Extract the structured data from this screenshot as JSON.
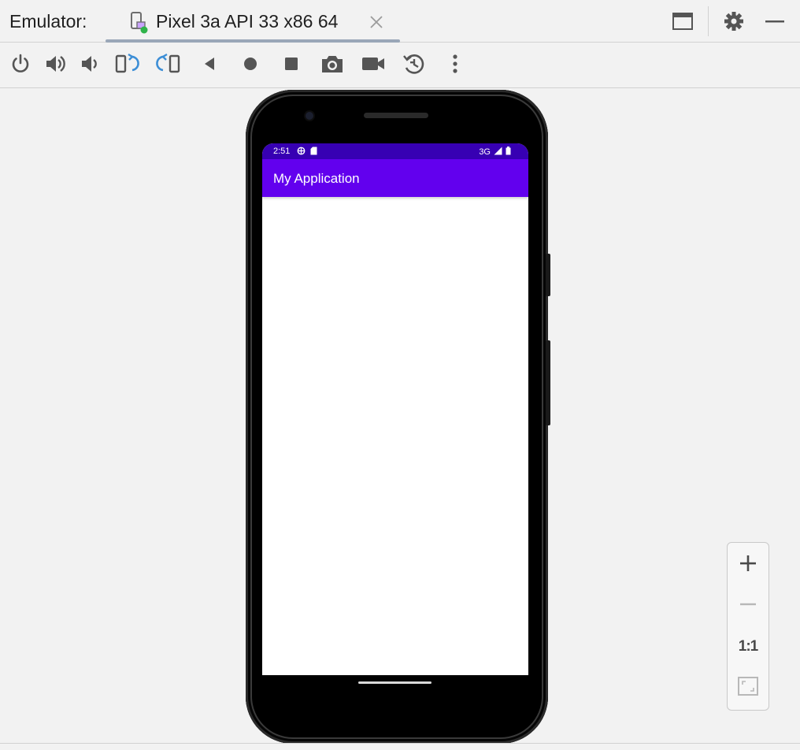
{
  "header": {
    "title": "Emulator:",
    "tab": {
      "label": "Pixel 3a API 33 x86 64"
    }
  },
  "toolbar": {
    "items": [
      {
        "name": "power-icon"
      },
      {
        "name": "volume-up-icon"
      },
      {
        "name": "volume-down-icon"
      },
      {
        "name": "rotate-left-icon"
      },
      {
        "name": "rotate-right-icon"
      },
      {
        "name": "back-icon"
      },
      {
        "name": "home-icon"
      },
      {
        "name": "overview-icon"
      },
      {
        "name": "screenshot-camera-icon"
      },
      {
        "name": "screen-record-icon"
      },
      {
        "name": "snapshot-icon"
      },
      {
        "name": "more-options-icon"
      }
    ]
  },
  "device": {
    "status_bar": {
      "time": "2:51",
      "network": "3G"
    },
    "app_bar": {
      "title": "My Application"
    }
  },
  "zoom": {
    "zoom_in": "+",
    "zoom_out": "−",
    "actual_size": "1:1"
  },
  "colors": {
    "status_bar": "#3700b3",
    "app_bar": "#6200ee",
    "accent_blue": "#3c8ed6",
    "icon_gray": "#5a5a5a"
  }
}
